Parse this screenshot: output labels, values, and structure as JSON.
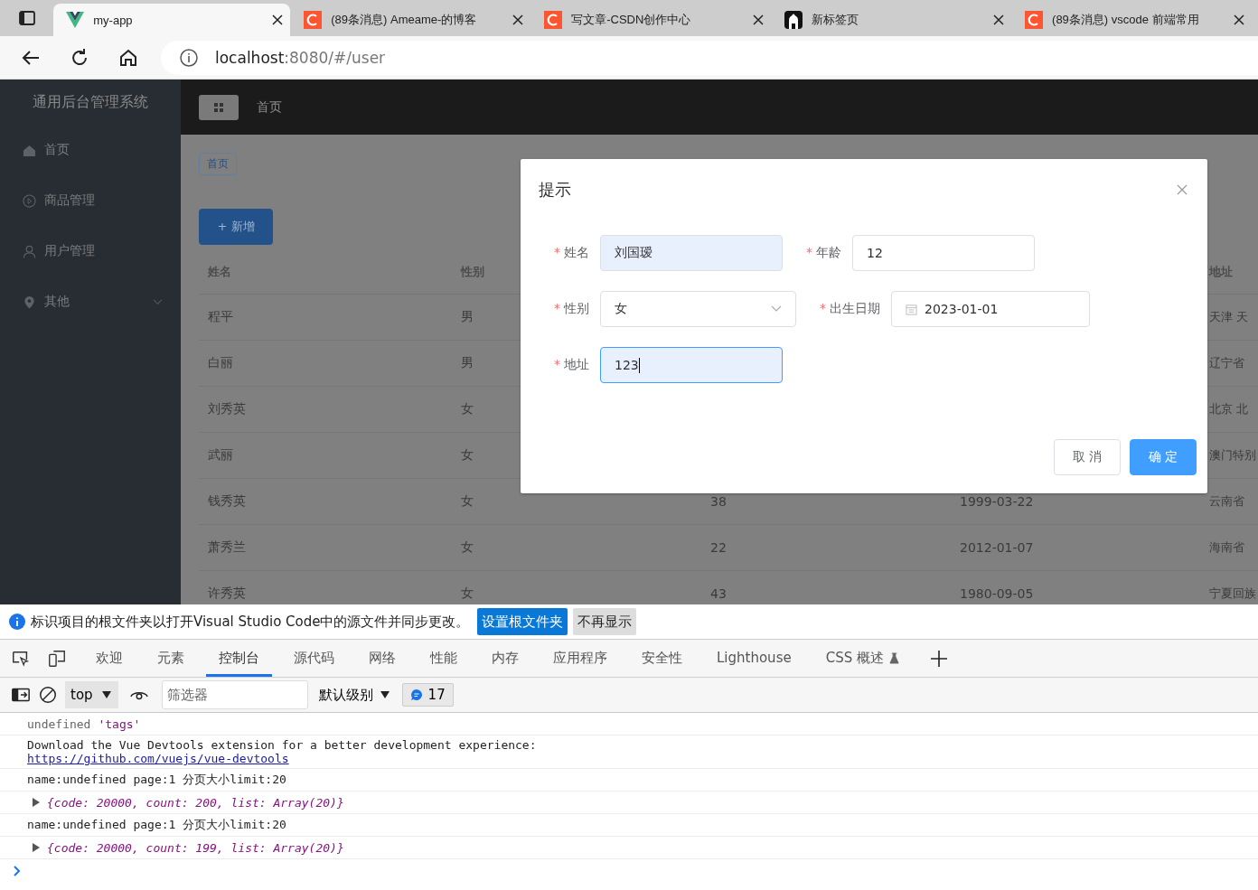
{
  "browser": {
    "tabs": [
      {
        "title": "my-app",
        "selected": true,
        "kind": "vue"
      },
      {
        "title": "(89条消息) Ameame-的博客",
        "selected": false,
        "kind": "csdn"
      },
      {
        "title": "写文章-CSDN创作中心",
        "selected": false,
        "kind": "csdn"
      },
      {
        "title": "新标签页",
        "selected": false,
        "kind": "dark"
      },
      {
        "title": "(89条消息) vscode 前端常用",
        "selected": false,
        "kind": "csdn"
      }
    ],
    "address": {
      "host": "localhost",
      "path": ":8080/#/user"
    }
  },
  "sidebar": {
    "title": "通用后台管理系统",
    "items": [
      {
        "label": "首页",
        "submenu": false
      },
      {
        "label": "商品管理",
        "submenu": false
      },
      {
        "label": "用户管理",
        "submenu": false
      },
      {
        "label": "其他",
        "submenu": true
      }
    ]
  },
  "header": {
    "breadcrumb": "首页"
  },
  "tags": [
    {
      "label": "首页",
      "selected": true
    }
  ],
  "add_button": "+ 新增",
  "table": {
    "header": {
      "name": "姓名",
      "gender": "性别",
      "address": "地址"
    },
    "rows": [
      {
        "name": "程平",
        "gender": "男",
        "address": "天津 天"
      },
      {
        "name": "白丽",
        "gender": "男",
        "address": "辽宁省"
      },
      {
        "name": "刘秀英",
        "gender": "女",
        "address": "北京 北"
      },
      {
        "name": "武丽",
        "gender": "女",
        "address": "澳门特别"
      },
      {
        "name": "钱秀英",
        "gender": "女",
        "age": "38",
        "birthday": "1999-03-22",
        "address": "云南省"
      },
      {
        "name": "萧秀兰",
        "gender": "女",
        "age": "22",
        "birthday": "2012-01-07",
        "address": "海南省"
      },
      {
        "name": "许秀英",
        "gender": "女",
        "age": "43",
        "birthday": "1980-09-05",
        "address": "宁夏回族"
      }
    ]
  },
  "dialog": {
    "title": "提示",
    "fields": [
      {
        "kind": "text",
        "label": "姓名",
        "value": "刘国瑷",
        "required_mark": "*",
        "autofilled": true,
        "focused": false
      },
      {
        "kind": "text",
        "label": "年龄",
        "value": "12",
        "required_mark": "*",
        "autofilled": false,
        "focused": false
      },
      {
        "kind": "select",
        "label": "性别",
        "value": "女",
        "required_mark": "*",
        "autofilled": false,
        "focused": false
      },
      {
        "kind": "date",
        "label": "出生日期",
        "value": "2023-01-01",
        "required_mark": "*",
        "autofilled": false,
        "focused": false
      },
      {
        "kind": "text",
        "label": "地址",
        "value": "123",
        "required_mark": "*",
        "autofilled": true,
        "focused": true
      }
    ],
    "buttons": [
      {
        "label": "取 消",
        "primary": false
      },
      {
        "label": "确 定",
        "primary": true
      }
    ]
  },
  "devtools": {
    "notice": {
      "text": "标识项目的根文件夹以打开Visual Studio Code中的源文件并同步更改。",
      "buttons": [
        {
          "label": "设置根文件夹",
          "primary": true
        },
        {
          "label": "不再显示",
          "primary": false
        }
      ]
    },
    "tabs": [
      {
        "label": "欢迎",
        "selected": false
      },
      {
        "label": "元素",
        "selected": false
      },
      {
        "label": "控制台",
        "selected": true
      },
      {
        "label": "源代码",
        "selected": false
      },
      {
        "label": "网络",
        "selected": false
      },
      {
        "label": "性能",
        "selected": false
      },
      {
        "label": "内存",
        "selected": false
      },
      {
        "label": "应用程序",
        "selected": false
      },
      {
        "label": "安全性",
        "selected": false
      },
      {
        "label": "Lighthouse",
        "selected": false
      },
      {
        "label": "CSS 概述",
        "selected": false
      }
    ],
    "context": "top",
    "filter_placeholder": "筛选器",
    "level": "默认级别",
    "message_count": "17",
    "console": [
      {
        "kind": "value",
        "value": "undefined",
        "string": "'tags'"
      },
      {
        "kind": "link",
        "text": "Download the Vue Devtools extension for a better development experience:",
        "link": "https://github.com/vuejs/vue-devtools"
      },
      {
        "kind": "text",
        "text": "name:undefined page:1 分页大小limit:20"
      },
      {
        "kind": "object",
        "text": "{code: 20000, count: 200, list: Array(20)}"
      },
      {
        "kind": "text",
        "text": "name:undefined page:1 分页大小limit:20"
      },
      {
        "kind": "object",
        "text": "{code: 20000, count: 199, list: Array(20)}"
      }
    ]
  }
}
